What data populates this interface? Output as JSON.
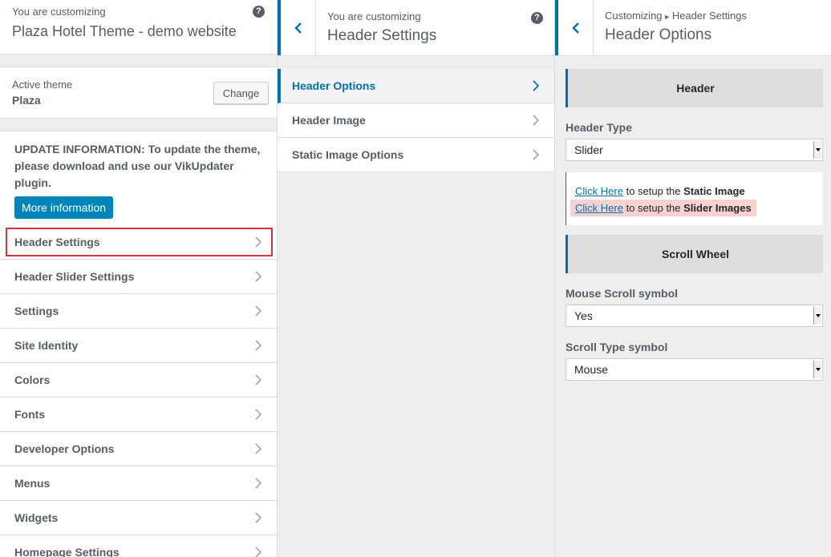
{
  "panel1": {
    "customizing_label": "You are customizing",
    "site_title": "Plaza Hotel Theme - demo website",
    "active_theme_label": "Active theme",
    "active_theme_name": "Plaza",
    "change_label": "Change",
    "update_text": "UPDATE INFORMATION: To update the theme, please download and use our VikUpdater plugin.",
    "more_info_label": "More information",
    "menu": [
      {
        "label": "Header Settings",
        "highlighted": true
      },
      {
        "label": "Header Slider Settings"
      },
      {
        "label": "Settings"
      },
      {
        "label": "Site Identity"
      },
      {
        "label": "Colors"
      },
      {
        "label": "Fonts"
      },
      {
        "label": "Developer Options"
      },
      {
        "label": "Menus"
      },
      {
        "label": "Widgets"
      },
      {
        "label": "Homepage Settings"
      }
    ]
  },
  "panel2": {
    "customizing_label": "You are customizing",
    "title": "Header Settings",
    "sections": [
      {
        "label": "Header Options",
        "active": true
      },
      {
        "label": "Header Image"
      },
      {
        "label": "Static Image Options"
      }
    ]
  },
  "panel3": {
    "breadcrumb_root": "Customizing",
    "breadcrumb_sep": "▸",
    "breadcrumb_parent": "Header Settings",
    "title": "Header Options",
    "header_section": "Header",
    "header_type_label": "Header Type",
    "header_type_value": "Slider",
    "info": {
      "link1": "Click Here",
      "text1_pre": " to setup the ",
      "text1_bold": "Static Image",
      "link2": "Click Here",
      "text2_pre": " to setup the ",
      "text2_bold": "Slider Images"
    },
    "scroll_section": "Scroll Wheel",
    "mouse_scroll_label": "Mouse Scroll symbol",
    "mouse_scroll_value": "Yes",
    "scroll_type_label": "Scroll Type symbol",
    "scroll_type_value": "Mouse"
  },
  "colors": {
    "accent": "#0073aa",
    "button_primary": "#0085ba",
    "highlight_border": "#d63638",
    "highlight_bg": "#f8d1d1"
  },
  "icons": [
    "help-icon",
    "chevron-right-icon",
    "chevron-left-icon",
    "dropdown-arrow-icon"
  ]
}
